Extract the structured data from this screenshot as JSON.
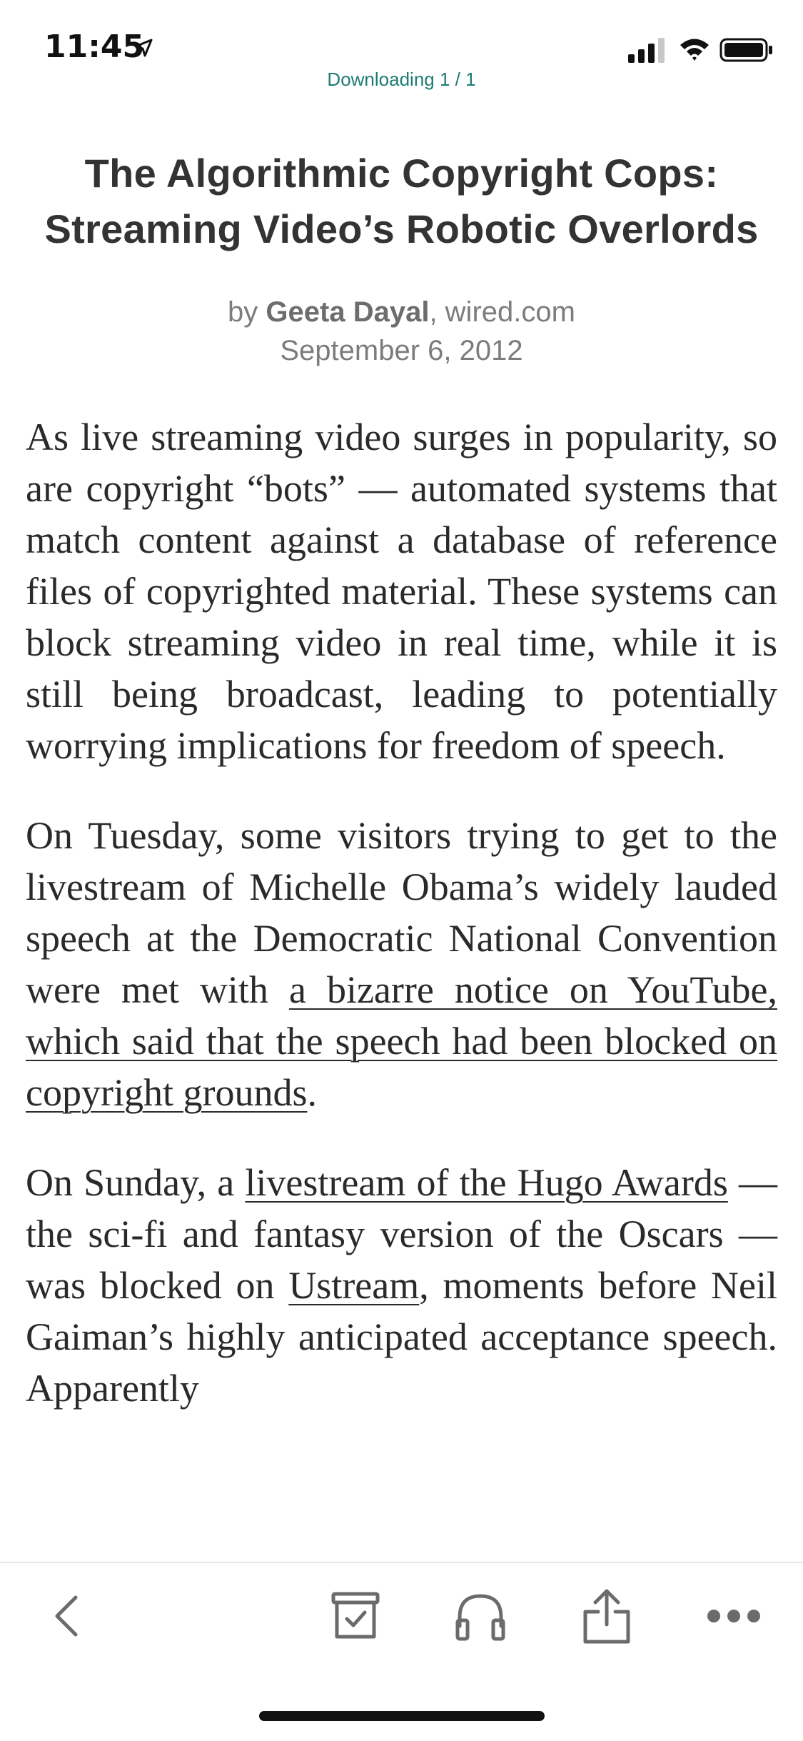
{
  "status_bar": {
    "time": "11:45",
    "location_icon": "location-arrow-icon",
    "signal_icon": "cellular-signal-icon",
    "wifi_icon": "wifi-icon",
    "battery_icon": "battery-icon"
  },
  "download_status": "Downloading 1 / 1",
  "article": {
    "title_line1": "The Algorithmic Copyright Cops:",
    "title_line2": "Streaming Video’s Robotic Overlords",
    "byline": {
      "prefix": "by ",
      "author": "Geeta Dayal",
      "source": ", wired.com",
      "date": "September 6, 2012"
    },
    "p1": "As live streaming video surges in popularity, so are copyright “bots” — automated systems that match content against a database of reference files of copyrighted material. These systems can block streaming video in real time, while it is still being broadcast, leading to potentially worrying implications for freedom of speech.",
    "p2_text1": "On Tuesday, some visitors trying to get to the livestream of Michelle Obama’s widely lauded speech at the Democratic National Convention were met with ",
    "p2_link1": "a bizarre notice on YouTube, which said that the speech had been blocked on copyright grounds",
    "p2_text2": ".",
    "p3_text1": "On Sunday, a ",
    "p3_link1": "livestream of the Hugo Awards",
    "p3_text2": " — the sci-fi and fantasy version of the Oscars — was blocked on ",
    "p3_link2": "Ustream",
    "p3_text3": ", moments before Neil Gaiman’s highly anticipated acceptance speech. Apparently"
  },
  "toolbar": {
    "back_icon": "chevron-left-icon",
    "archive_icon": "archive-check-icon",
    "listen_icon": "headphones-icon",
    "share_icon": "share-icon",
    "more_icon": "more-dots-icon"
  },
  "colors": {
    "accent": "#1d7c74",
    "text": "#2a2a2a",
    "muted": "#7c7c7c",
    "icon": "#6b6b6b"
  }
}
